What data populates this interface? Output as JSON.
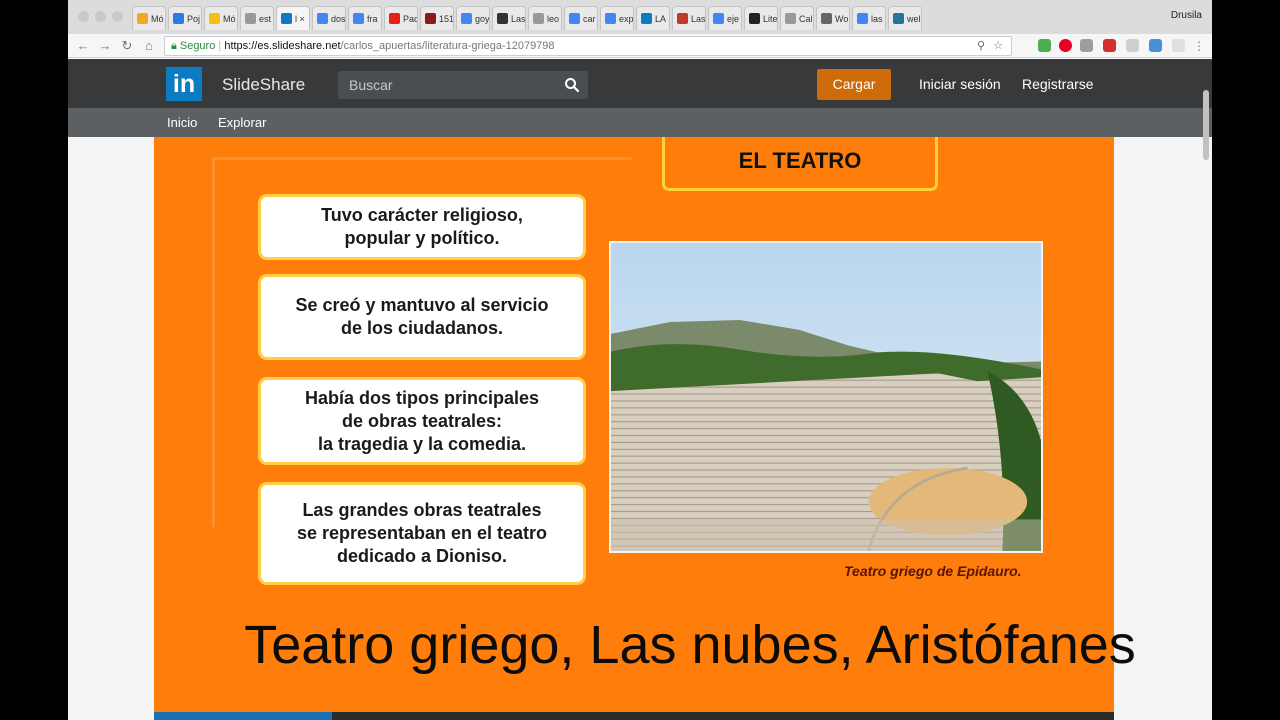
{
  "browser": {
    "tabs": [
      {
        "label": "Mó",
        "favicon": "folder-icon",
        "color": "#f5a623"
      },
      {
        "label": "Poj",
        "favicon": "p-icon",
        "color": "#2c7be5"
      },
      {
        "label": "Mó",
        "favicon": "slides-icon",
        "color": "#f4c20d"
      },
      {
        "label": "est",
        "favicon": "doc-icon",
        "color": "#999999"
      },
      {
        "label": "l ×",
        "favicon": "linkedin-icon",
        "color": "#0b7cc2"
      },
      {
        "label": "dos",
        "favicon": "google-icon",
        "color": "#4285f4"
      },
      {
        "label": "fra",
        "favicon": "google-icon",
        "color": "#4285f4"
      },
      {
        "label": "Pac",
        "favicon": "youtube-icon",
        "color": "#e62117"
      },
      {
        "label": "151",
        "favicon": "ta-icon",
        "color": "#8b1a1a"
      },
      {
        "label": "goy",
        "favicon": "google-icon",
        "color": "#4285f4"
      },
      {
        "label": "Las",
        "favicon": "github-icon",
        "color": "#333333"
      },
      {
        "label": "leo",
        "favicon": "doc-icon",
        "color": "#999999"
      },
      {
        "label": "car",
        "favicon": "google-icon",
        "color": "#4285f4"
      },
      {
        "label": "exp",
        "favicon": "google-icon",
        "color": "#4285f4"
      },
      {
        "label": "LA",
        "favicon": "linkedin-icon",
        "color": "#0b7cc2"
      },
      {
        "label": "Las",
        "favicon": "s-icon",
        "color": "#c0392b"
      },
      {
        "label": "eje",
        "favicon": "google-icon",
        "color": "#4285f4"
      },
      {
        "label": "Lite",
        "favicon": "e-icon",
        "color": "#222222"
      },
      {
        "label": "Cal",
        "favicon": "doc-icon",
        "color": "#999999"
      },
      {
        "label": "Wo",
        "favicon": "globe-icon",
        "color": "#666666"
      },
      {
        "label": "las",
        "favicon": "google-icon",
        "color": "#4285f4"
      },
      {
        "label": "wel",
        "favicon": "wordpress-icon",
        "color": "#21759b"
      }
    ],
    "active_tab_index": 4,
    "profile_name": "Drusila",
    "secure_label": "Seguro",
    "url_host": "https://es.slideshare.net",
    "url_path": "/carlos_apuertas/literatura-griega-12079798"
  },
  "slideshare": {
    "logo_text": "in",
    "brand": "SlideShare",
    "search_placeholder": "Buscar",
    "upload_label": "Cargar",
    "login_label": "Iniciar sesión",
    "signup_label": "Registrarse",
    "subnav": [
      "Inicio",
      "Explorar"
    ],
    "accent_color": "#cd6a09"
  },
  "slide": {
    "title": "EL TEATRO",
    "cards": [
      "Tuvo carácter religioso,\npopular y político.",
      "Se creó y mantuvo al servicio\nde los ciudadanos.",
      "Había dos tipos principales\nde obras teatrales:\nla tragedia y la comedia.",
      "Las grandes obras teatrales\nse representaban en el teatro\ndedicado a Dioniso."
    ],
    "caption": "Teatro griego de Epidauro.",
    "background_color": "#ff7d0a",
    "progress_fraction": 0.185
  },
  "overlay_subtitle": "Teatro griego, Las nubes, Aristófanes"
}
